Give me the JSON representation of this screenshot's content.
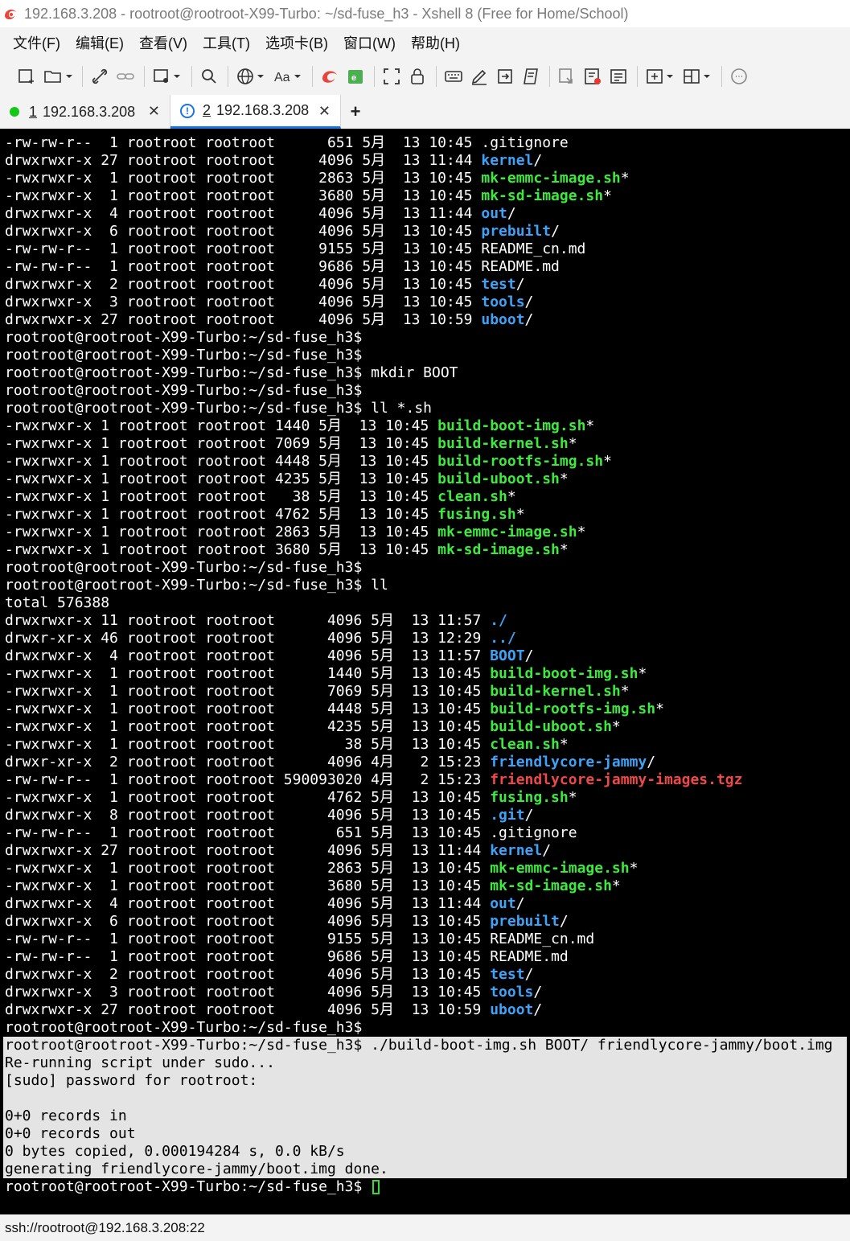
{
  "window": {
    "title": "192.168.3.208 - rootroot@rootroot-X99-Turbo: ~/sd-fuse_h3 - Xshell 8 (Free for Home/School)"
  },
  "menu": [
    "文件(F)",
    "编辑(E)",
    "查看(V)",
    "工具(T)",
    "选项卡(B)",
    "窗口(W)",
    "帮助(H)"
  ],
  "tabs": [
    {
      "num": "1",
      "label": " 192.168.3.208"
    },
    {
      "num": "2",
      "label": " 192.168.3.208"
    }
  ],
  "tab_close": "✕",
  "tab_add": "+",
  "terminal": {
    "lines": [
      {
        "segs": [
          {
            "t": "-rw-rw-r--  1 rootroot rootroot      651 5月  13 10:45 "
          },
          {
            "t": ".gitignore"
          }
        ]
      },
      {
        "segs": [
          {
            "t": "drwxrwxr-x 27 rootroot rootroot     4096 5月  13 11:44 "
          },
          {
            "t": "kernel",
            "c": "dir"
          },
          {
            "t": "/"
          }
        ]
      },
      {
        "segs": [
          {
            "t": "-rwxrwxr-x  1 rootroot rootroot     2863 5月  13 10:45 "
          },
          {
            "t": "mk-emmc-image.sh",
            "c": "exe"
          },
          {
            "t": "*"
          }
        ]
      },
      {
        "segs": [
          {
            "t": "-rwxrwxr-x  1 rootroot rootroot     3680 5月  13 10:45 "
          },
          {
            "t": "mk-sd-image.sh",
            "c": "exe"
          },
          {
            "t": "*"
          }
        ]
      },
      {
        "segs": [
          {
            "t": "drwxrwxr-x  4 rootroot rootroot     4096 5月  13 11:44 "
          },
          {
            "t": "out",
            "c": "dir"
          },
          {
            "t": "/"
          }
        ]
      },
      {
        "segs": [
          {
            "t": "drwxrwxr-x  6 rootroot rootroot     4096 5月  13 10:45 "
          },
          {
            "t": "prebuilt",
            "c": "dir"
          },
          {
            "t": "/"
          }
        ]
      },
      {
        "segs": [
          {
            "t": "-rw-rw-r--  1 rootroot rootroot     9155 5月  13 10:45 README_cn.md"
          }
        ]
      },
      {
        "segs": [
          {
            "t": "-rw-rw-r--  1 rootroot rootroot     9686 5月  13 10:45 README.md"
          }
        ]
      },
      {
        "segs": [
          {
            "t": "drwxrwxr-x  2 rootroot rootroot     4096 5月  13 10:45 "
          },
          {
            "t": "test",
            "c": "dir"
          },
          {
            "t": "/"
          }
        ]
      },
      {
        "segs": [
          {
            "t": "drwxrwxr-x  3 rootroot rootroot     4096 5月  13 10:45 "
          },
          {
            "t": "tools",
            "c": "dir"
          },
          {
            "t": "/"
          }
        ]
      },
      {
        "segs": [
          {
            "t": "drwxrwxr-x 27 rootroot rootroot     4096 5月  13 10:59 "
          },
          {
            "t": "uboot",
            "c": "dir"
          },
          {
            "t": "/"
          }
        ]
      },
      {
        "segs": [
          {
            "t": "rootroot@rootroot-X99-Turbo:~/sd-fuse_h3$"
          }
        ]
      },
      {
        "segs": [
          {
            "t": "rootroot@rootroot-X99-Turbo:~/sd-fuse_h3$"
          }
        ]
      },
      {
        "segs": [
          {
            "t": "rootroot@rootroot-X99-Turbo:~/sd-fuse_h3$ mkdir BOOT"
          }
        ]
      },
      {
        "segs": [
          {
            "t": "rootroot@rootroot-X99-Turbo:~/sd-fuse_h3$"
          }
        ]
      },
      {
        "segs": [
          {
            "t": "rootroot@rootroot-X99-Turbo:~/sd-fuse_h3$ ll *.sh"
          }
        ]
      },
      {
        "segs": [
          {
            "t": "-rwxrwxr-x 1 rootroot rootroot 1440 5月  13 10:45 "
          },
          {
            "t": "build-boot-img.sh",
            "c": "exe"
          },
          {
            "t": "*"
          }
        ]
      },
      {
        "segs": [
          {
            "t": "-rwxrwxr-x 1 rootroot rootroot 7069 5月  13 10:45 "
          },
          {
            "t": "build-kernel.sh",
            "c": "exe"
          },
          {
            "t": "*"
          }
        ]
      },
      {
        "segs": [
          {
            "t": "-rwxrwxr-x 1 rootroot rootroot 4448 5月  13 10:45 "
          },
          {
            "t": "build-rootfs-img.sh",
            "c": "exe"
          },
          {
            "t": "*"
          }
        ]
      },
      {
        "segs": [
          {
            "t": "-rwxrwxr-x 1 rootroot rootroot 4235 5月  13 10:45 "
          },
          {
            "t": "build-uboot.sh",
            "c": "exe"
          },
          {
            "t": "*"
          }
        ]
      },
      {
        "segs": [
          {
            "t": "-rwxrwxr-x 1 rootroot rootroot   38 5月  13 10:45 "
          },
          {
            "t": "clean.sh",
            "c": "exe"
          },
          {
            "t": "*"
          }
        ]
      },
      {
        "segs": [
          {
            "t": "-rwxrwxr-x 1 rootroot rootroot 4762 5月  13 10:45 "
          },
          {
            "t": "fusing.sh",
            "c": "exe"
          },
          {
            "t": "*"
          }
        ]
      },
      {
        "segs": [
          {
            "t": "-rwxrwxr-x 1 rootroot rootroot 2863 5月  13 10:45 "
          },
          {
            "t": "mk-emmc-image.sh",
            "c": "exe"
          },
          {
            "t": "*"
          }
        ]
      },
      {
        "segs": [
          {
            "t": "-rwxrwxr-x 1 rootroot rootroot 3680 5月  13 10:45 "
          },
          {
            "t": "mk-sd-image.sh",
            "c": "exe"
          },
          {
            "t": "*"
          }
        ]
      },
      {
        "segs": [
          {
            "t": "rootroot@rootroot-X99-Turbo:~/sd-fuse_h3$"
          }
        ]
      },
      {
        "segs": [
          {
            "t": "rootroot@rootroot-X99-Turbo:~/sd-fuse_h3$ ll"
          }
        ]
      },
      {
        "segs": [
          {
            "t": "total 576388"
          }
        ]
      },
      {
        "segs": [
          {
            "t": "drwxrwxr-x 11 rootroot rootroot      4096 5月  13 11:57 "
          },
          {
            "t": "./",
            "c": "dir"
          }
        ]
      },
      {
        "segs": [
          {
            "t": "drwxr-xr-x 46 rootroot rootroot      4096 5月  13 12:29 "
          },
          {
            "t": "../",
            "c": "dir"
          }
        ]
      },
      {
        "segs": [
          {
            "t": "drwxrwxr-x  4 rootroot rootroot      4096 5月  13 11:57 "
          },
          {
            "t": "BOOT",
            "c": "dir"
          },
          {
            "t": "/"
          }
        ]
      },
      {
        "segs": [
          {
            "t": "-rwxrwxr-x  1 rootroot rootroot      1440 5月  13 10:45 "
          },
          {
            "t": "build-boot-img.sh",
            "c": "exe"
          },
          {
            "t": "*"
          }
        ]
      },
      {
        "segs": [
          {
            "t": "-rwxrwxr-x  1 rootroot rootroot      7069 5月  13 10:45 "
          },
          {
            "t": "build-kernel.sh",
            "c": "exe"
          },
          {
            "t": "*"
          }
        ]
      },
      {
        "segs": [
          {
            "t": "-rwxrwxr-x  1 rootroot rootroot      4448 5月  13 10:45 "
          },
          {
            "t": "build-rootfs-img.sh",
            "c": "exe"
          },
          {
            "t": "*"
          }
        ]
      },
      {
        "segs": [
          {
            "t": "-rwxrwxr-x  1 rootroot rootroot      4235 5月  13 10:45 "
          },
          {
            "t": "build-uboot.sh",
            "c": "exe"
          },
          {
            "t": "*"
          }
        ]
      },
      {
        "segs": [
          {
            "t": "-rwxrwxr-x  1 rootroot rootroot        38 5月  13 10:45 "
          },
          {
            "t": "clean.sh",
            "c": "exe"
          },
          {
            "t": "*"
          }
        ]
      },
      {
        "segs": [
          {
            "t": "drwxr-xr-x  2 rootroot rootroot      4096 4月   2 15:23 "
          },
          {
            "t": "friendlycore-jammy",
            "c": "dir"
          },
          {
            "t": "/"
          }
        ]
      },
      {
        "segs": [
          {
            "t": "-rw-rw-r--  1 rootroot rootroot 590093020 4月   2 15:23 "
          },
          {
            "t": "friendlycore-jammy-images.tgz",
            "c": "arc"
          }
        ]
      },
      {
        "segs": [
          {
            "t": "-rwxrwxr-x  1 rootroot rootroot      4762 5月  13 10:45 "
          },
          {
            "t": "fusing.sh",
            "c": "exe"
          },
          {
            "t": "*"
          }
        ]
      },
      {
        "segs": [
          {
            "t": "drwxrwxr-x  8 rootroot rootroot      4096 5月  13 10:45 "
          },
          {
            "t": ".git",
            "c": "dir"
          },
          {
            "t": "/"
          }
        ]
      },
      {
        "segs": [
          {
            "t": "-rw-rw-r--  1 rootroot rootroot       651 5月  13 10:45 .gitignore"
          }
        ]
      },
      {
        "segs": [
          {
            "t": "drwxrwxr-x 27 rootroot rootroot      4096 5月  13 11:44 "
          },
          {
            "t": "kernel",
            "c": "dir"
          },
          {
            "t": "/"
          }
        ]
      },
      {
        "segs": [
          {
            "t": "-rwxrwxr-x  1 rootroot rootroot      2863 5月  13 10:45 "
          },
          {
            "t": "mk-emmc-image.sh",
            "c": "exe"
          },
          {
            "t": "*"
          }
        ]
      },
      {
        "segs": [
          {
            "t": "-rwxrwxr-x  1 rootroot rootroot      3680 5月  13 10:45 "
          },
          {
            "t": "mk-sd-image.sh",
            "c": "exe"
          },
          {
            "t": "*"
          }
        ]
      },
      {
        "segs": [
          {
            "t": "drwxrwxr-x  4 rootroot rootroot      4096 5月  13 11:44 "
          },
          {
            "t": "out",
            "c": "dir"
          },
          {
            "t": "/"
          }
        ]
      },
      {
        "segs": [
          {
            "t": "drwxrwxr-x  6 rootroot rootroot      4096 5月  13 10:45 "
          },
          {
            "t": "prebuilt",
            "c": "dir"
          },
          {
            "t": "/"
          }
        ]
      },
      {
        "segs": [
          {
            "t": "-rw-rw-r--  1 rootroot rootroot      9155 5月  13 10:45 README_cn.md"
          }
        ]
      },
      {
        "segs": [
          {
            "t": "-rw-rw-r--  1 rootroot rootroot      9686 5月  13 10:45 README.md"
          }
        ]
      },
      {
        "segs": [
          {
            "t": "drwxrwxr-x  2 rootroot rootroot      4096 5月  13 10:45 "
          },
          {
            "t": "test",
            "c": "dir"
          },
          {
            "t": "/"
          }
        ]
      },
      {
        "segs": [
          {
            "t": "drwxrwxr-x  3 rootroot rootroot      4096 5月  13 10:45 "
          },
          {
            "t": "tools",
            "c": "dir"
          },
          {
            "t": "/"
          }
        ]
      },
      {
        "segs": [
          {
            "t": "drwxrwxr-x 27 rootroot rootroot      4096 5月  13 10:59 "
          },
          {
            "t": "uboot",
            "c": "dir"
          },
          {
            "t": "/"
          }
        ]
      },
      {
        "segs": [
          {
            "t": "rootroot@rootroot-X99-Turbo:~/sd-fuse_h3$"
          }
        ]
      },
      {
        "segs": [
          {
            "t": "rootroot@rootroot-X99-Turbo:~/sd-fuse_h3$ ./build-boot-img.sh BOOT/ friendlycore-jammy/boot.img"
          }
        ],
        "hl": true
      },
      {
        "segs": [
          {
            "t": "Re-running script under sudo..."
          }
        ],
        "hl": true
      },
      {
        "segs": [
          {
            "t": "[sudo] password for rootroot:"
          }
        ],
        "hl": true
      },
      {
        "segs": [
          {
            "t": ""
          }
        ],
        "hl": true
      },
      {
        "segs": [
          {
            "t": "0+0 records in"
          }
        ],
        "hl": true
      },
      {
        "segs": [
          {
            "t": "0+0 records out"
          }
        ],
        "hl": true
      },
      {
        "segs": [
          {
            "t": "0 bytes copied, 0.000194284 s, 0.0 kB/s"
          }
        ],
        "hl": true
      },
      {
        "segs": [
          {
            "t": "generating friendlycore-jammy/boot.img done."
          }
        ],
        "hl": true
      },
      {
        "segs": [
          {
            "t": "rootroot@rootroot-X99-Turbo:~/sd-fuse_h3$ "
          }
        ],
        "cursor": true
      }
    ]
  },
  "statusbar": {
    "text": "ssh://rootroot@192.168.3.208:22"
  }
}
